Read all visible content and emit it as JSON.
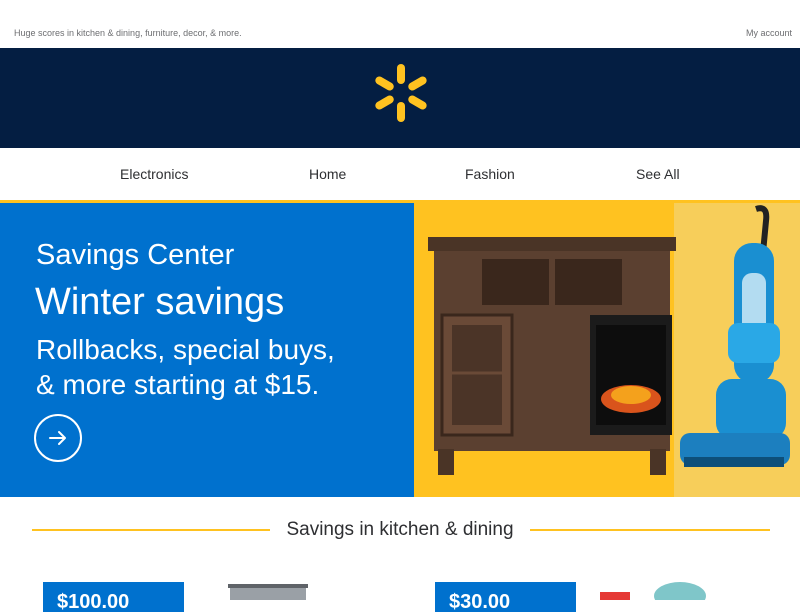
{
  "preheader": {
    "text": "Huge scores in kitchen & dining, furniture, decor, & more.",
    "account_link": "My account"
  },
  "brand": {
    "logo": "walmart-spark-icon",
    "header_color": "#041e42",
    "spark_color": "#ffc220"
  },
  "nav": {
    "items": [
      {
        "label": "Electronics"
      },
      {
        "label": "Home"
      },
      {
        "label": "Fashion"
      },
      {
        "label": "See All"
      }
    ]
  },
  "hero": {
    "eyebrow": "Savings Center",
    "headline": "Winter savings",
    "subline1": "Rollbacks, special buys,",
    "subline2": "& more starting at $15.",
    "cta_icon": "arrow-right-circle-icon",
    "colors": {
      "left_bg": "#0071ce",
      "right_bg": "#ffc220"
    }
  },
  "section": {
    "title": "Savings in kitchen & dining"
  },
  "products": [
    {
      "price": "$100.00"
    },
    {
      "price": "$30.00"
    }
  ]
}
